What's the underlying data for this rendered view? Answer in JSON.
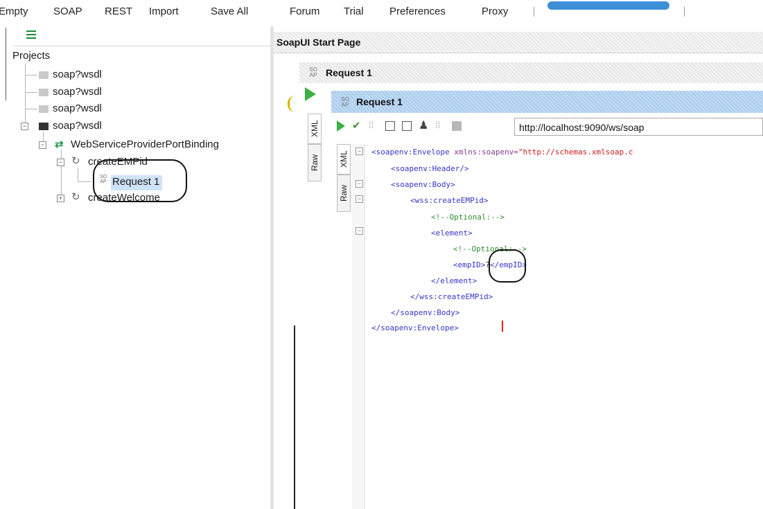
{
  "toolbar": {
    "items": [
      "Empty",
      "SOAP",
      "REST",
      "Import",
      "Save All",
      "Forum",
      "Trial",
      "Preferences",
      "Proxy"
    ]
  },
  "navigator": {
    "root_label": "Projects",
    "projects": [
      {
        "label": "soap?wsdl",
        "expanded": false
      },
      {
        "label": "soap?wsdl",
        "expanded": false
      },
      {
        "label": "soap?wsdl",
        "expanded": false
      },
      {
        "label": "soap?wsdl",
        "expanded": true
      }
    ],
    "binding": "WebServiceProviderPortBinding",
    "operations": [
      {
        "label": "createEMPid"
      },
      {
        "label": "createWelcome"
      }
    ],
    "request": {
      "label": "Request 1",
      "selected": true
    }
  },
  "workspace": {
    "start_page_tab": "SoapUI Start Page",
    "request_outer_title": "Request 1",
    "request_inner_title": "Request 1",
    "badge": {
      "top": "SO",
      "bottom": "AP"
    },
    "editor_tabs": {
      "xml": "XML",
      "raw": "Raw"
    },
    "endpoint_url": "http://localhost:9090/ws/soap",
    "colors": {
      "run_green": "#3cb043",
      "selected_blue": "#cfe3f7",
      "header_blue": "#a9ccee"
    }
  },
  "xml_lines": [
    {
      "tag": "<soapenv:Envelope",
      "attr": " xmlns:soapenv=",
      "str": "\"http://schemas.xmlsoap.c"
    },
    {
      "tag": "<soapenv:Header/>"
    },
    {
      "tag": "<soapenv:Body>"
    },
    {
      "tag": "<wss:createEMPid>"
    },
    {
      "com": "<!--Optional:-->"
    },
    {
      "tag": "<element>"
    },
    {
      "com": "<!--Optional:-->"
    },
    {
      "tag": "<empID>",
      "text": "?",
      "tag2": "</empID>"
    },
    {
      "tag": "</element>"
    },
    {
      "tag": "</wss:createEMPid>"
    },
    {
      "tag": "</soapenv:Body>"
    },
    {
      "tag": "</soapenv:Envelope>"
    }
  ]
}
